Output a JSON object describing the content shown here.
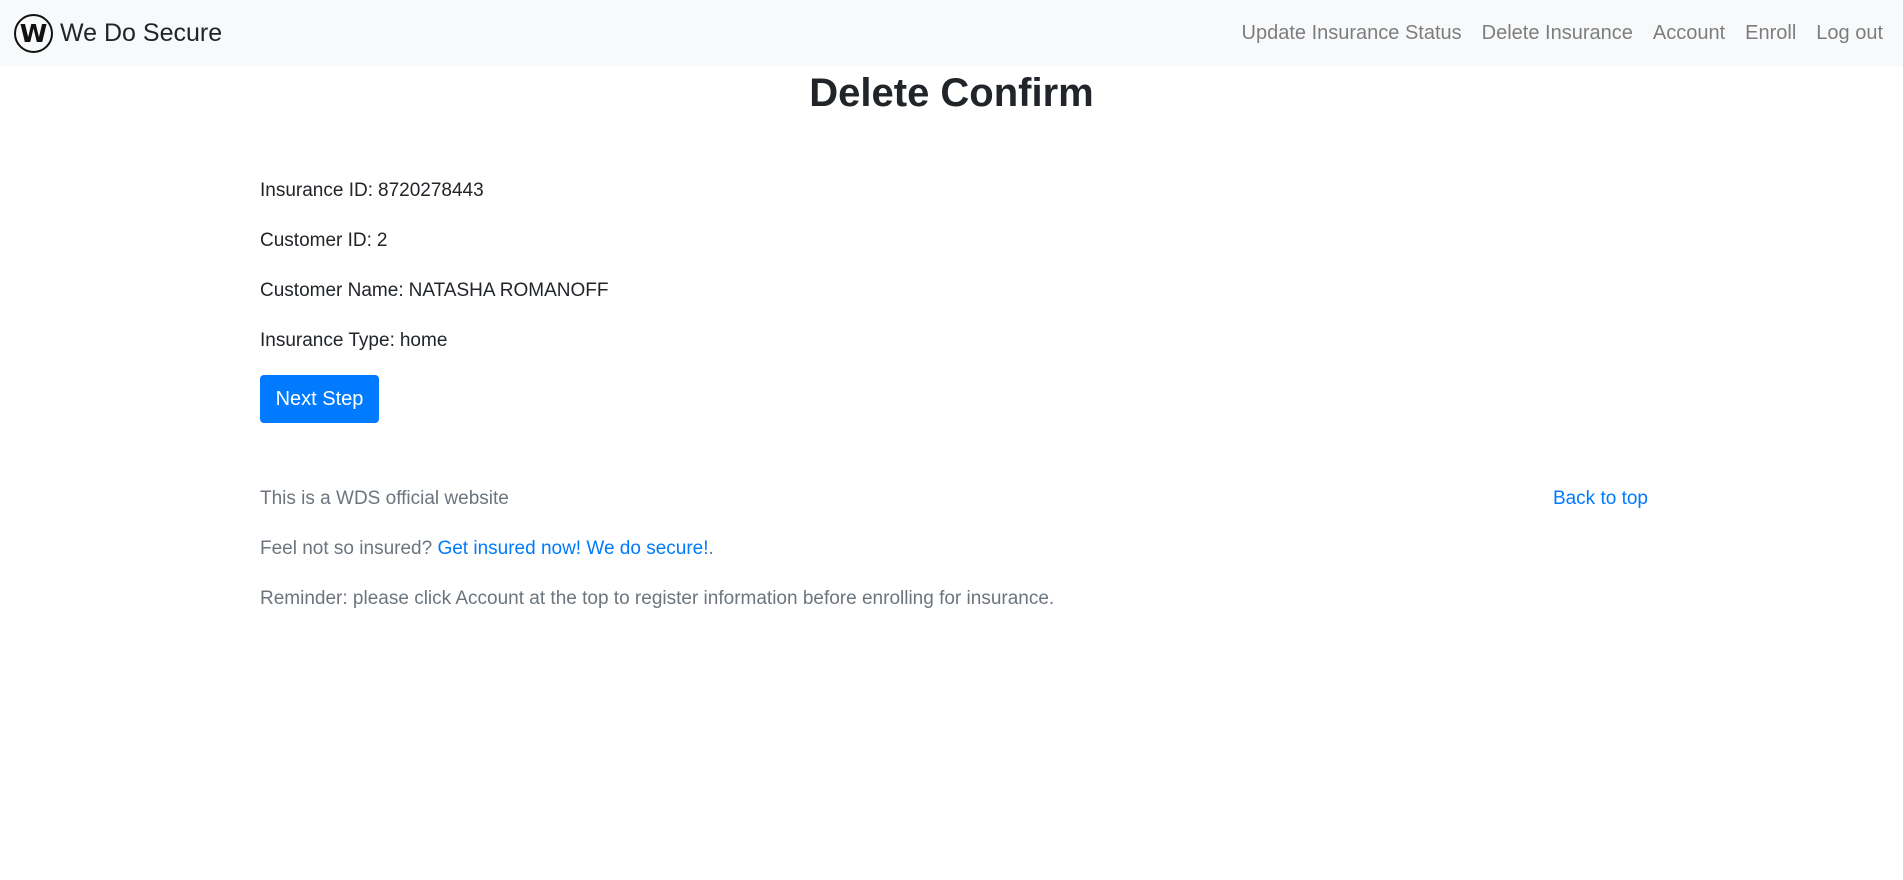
{
  "navbar": {
    "brand_letter": "W",
    "brand_name": "We Do Secure",
    "links": [
      {
        "label": "Update Insurance Status"
      },
      {
        "label": "Delete Insurance"
      },
      {
        "label": "Account"
      },
      {
        "label": "Enroll"
      },
      {
        "label": "Log out"
      }
    ]
  },
  "page": {
    "title": "Delete Confirm"
  },
  "details": [
    {
      "label": "Insurance ID:",
      "value": "8720278443"
    },
    {
      "label": "Customer ID:",
      "value": "2"
    },
    {
      "label": "Customer Name:",
      "value": "NATASHA ROMANOFF"
    },
    {
      "label": "Insurance Type:",
      "value": "home"
    }
  ],
  "actions": {
    "next_label": "Next Step"
  },
  "footer": {
    "official_text": "This is a WDS official website",
    "back_to_top": "Back to top",
    "insured_prefix": "Feel not so insured?",
    "insured_link": "Get insured now! We do secure!",
    "insured_suffix": ".",
    "reminder": "Reminder: please click Account at the top to register information before enrolling for insurance."
  },
  "colors": {
    "primary": "#007bff",
    "navbar_bg": "#f8f9fa",
    "muted": "#6c757d",
    "text": "#212529"
  }
}
